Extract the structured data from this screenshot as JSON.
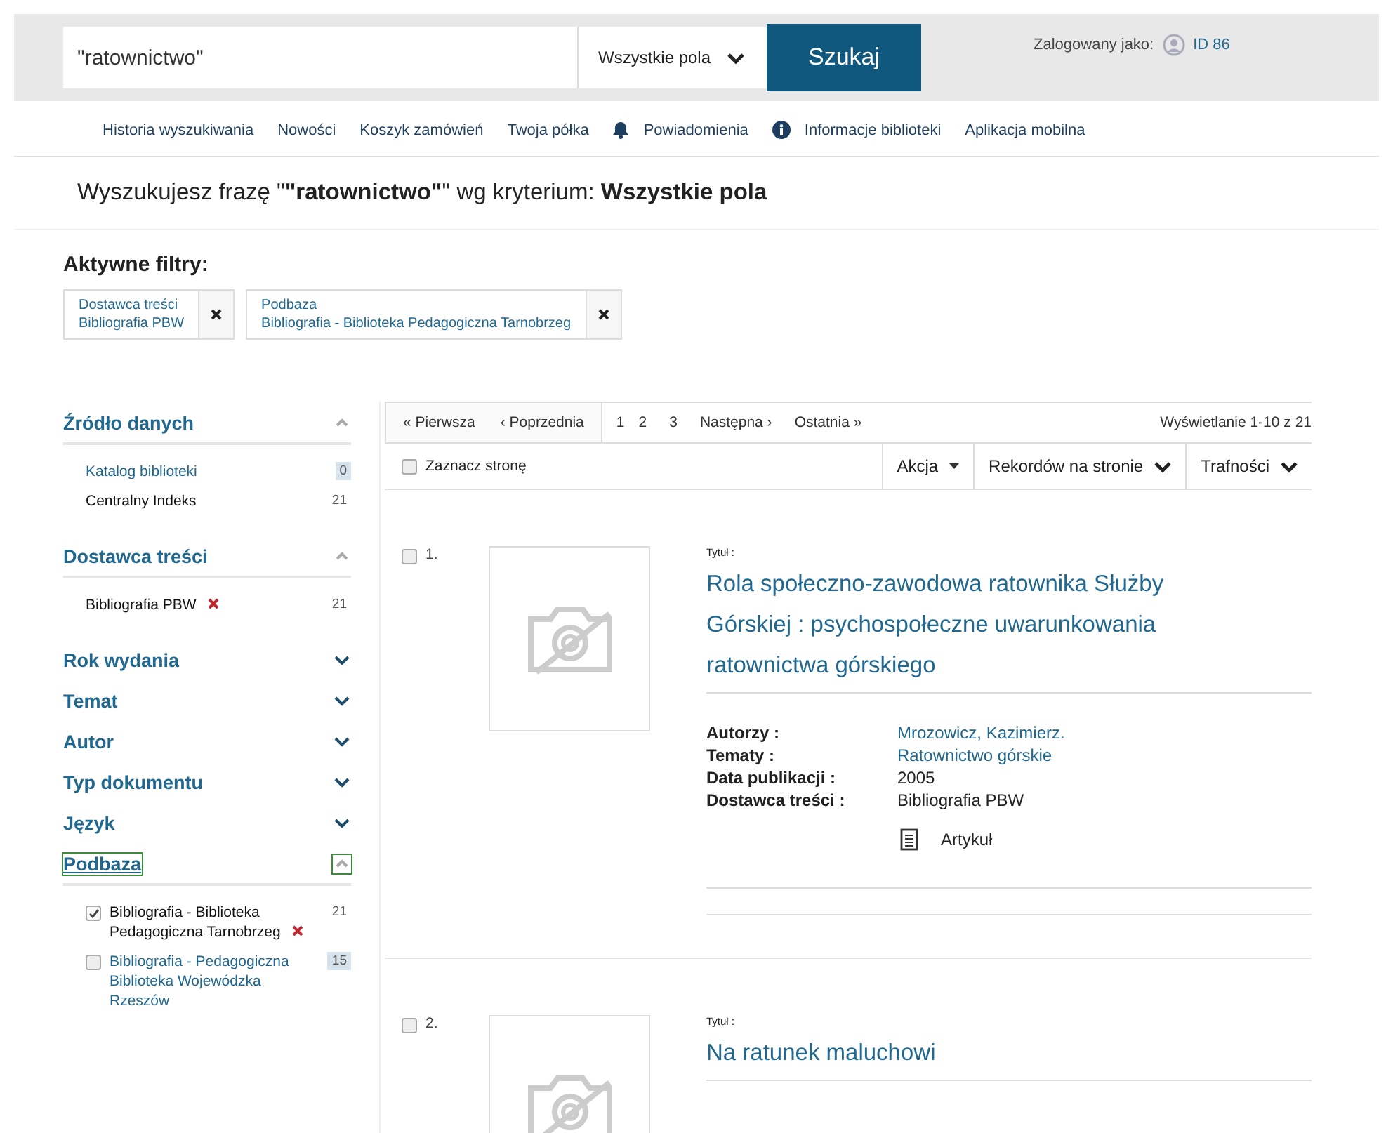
{
  "search": {
    "value": "\"ratownictwo\"",
    "field": "Wszystkie pola",
    "button": "Szukaj"
  },
  "user": {
    "label": "Zalogowany jako:",
    "id": "ID 86"
  },
  "nav": [
    {
      "label": "Historia wyszukiwania",
      "kind": "plain"
    },
    {
      "label": "Nowości",
      "kind": "plain"
    },
    {
      "label": "Koszyk zamówień",
      "kind": "plain"
    },
    {
      "label": "Twoja półka",
      "kind": "plain"
    },
    {
      "label": "Powiadomienia",
      "kind": "bell"
    },
    {
      "label": "Informacje biblioteki",
      "kind": "info"
    },
    {
      "label": "Aplikacja mobilna",
      "kind": "plain"
    }
  ],
  "heading": "Wyszukujesz frazę \"**\"ratownictwo\"**\" wg kryterium: **Wszystkie pola**",
  "active_filters": {
    "title": "Aktywne filtry:",
    "items": [
      {
        "name": "Dostawca treści",
        "value": "Bibliografia PBW"
      },
      {
        "name": "Podbaza",
        "value": "Bibliografia - Biblioteka Pedagogiczna Tarnobrzeg"
      }
    ]
  },
  "facets": [
    {
      "title": "Źródło danych",
      "expanded": true,
      "focused": false,
      "items": [
        {
          "label": "Katalog biblioteki",
          "count": "0",
          "selected": false,
          "kind": "link"
        },
        {
          "label": "Centralny Indeks",
          "count": "21",
          "selected": true,
          "kind": "link"
        }
      ]
    },
    {
      "title": "Dostawca treści",
      "expanded": true,
      "focused": false,
      "items": [
        {
          "label": "Bibliografia PBW",
          "count": "21",
          "selected": true,
          "kind": "link"
        }
      ]
    },
    {
      "title": "Rok wydania",
      "expanded": false,
      "focused": false
    },
    {
      "title": "Temat",
      "expanded": false,
      "focused": false
    },
    {
      "title": "Autor",
      "expanded": false,
      "focused": false
    },
    {
      "title": "Typ dokumentu",
      "expanded": false,
      "focused": false
    },
    {
      "title": "Język",
      "expanded": false,
      "focused": false
    },
    {
      "title": "Podbaza",
      "expanded": true,
      "focused": true,
      "items": [
        {
          "label": "Bibliografia - Biblioteka Pedagogiczna Tarnobrzeg",
          "count": "21",
          "selected": true,
          "kind": "checkbox"
        },
        {
          "label": "Bibliografia - Pedagogiczna Biblioteka Wojewódzka Rzeszów",
          "count": "15",
          "selected": false,
          "kind": "checkbox"
        }
      ]
    }
  ],
  "pagination": {
    "first": "« Pierwsza",
    "prev": "‹ Poprzednia",
    "pages": [
      {
        "label": "1",
        "selected": true
      },
      {
        "label": "2",
        "selected": false
      },
      {
        "label": "3",
        "selected": false
      }
    ],
    "next": "Następna ›",
    "last": "Ostatnia »",
    "summary": "Wyświetlanie 1-10 z 21"
  },
  "toolbar": {
    "select_page": "Zaznacz stronę",
    "select_checked": false,
    "action": "Akcja",
    "per_page": "Rekordów na stronie",
    "sort": "Trafności"
  },
  "results": [
    {
      "number": "1.",
      "checked": false,
      "title_label": "Tytuł :",
      "title": "Rola społeczno-zawodowa ratownika Służby Górskiej : psychospołeczne uwarunkowania ratownictwa górskiego",
      "fields": [
        {
          "label": "Autorzy :",
          "value": "Mrozowicz, Kazimierz.",
          "kind": "link"
        },
        {
          "label": "Tematy :",
          "value": "Ratownictwo górskie",
          "kind": "link"
        },
        {
          "label": "Data publikacji :",
          "value": "2005",
          "kind": "text"
        },
        {
          "label": "Dostawca treści :",
          "value": "Bibliografia PBW",
          "kind": "text"
        }
      ],
      "format": "Artykuł"
    },
    {
      "number": "2.",
      "checked": false,
      "title_label": "Tytuł :",
      "title": "Na ratunek maluchowi"
    }
  ]
}
